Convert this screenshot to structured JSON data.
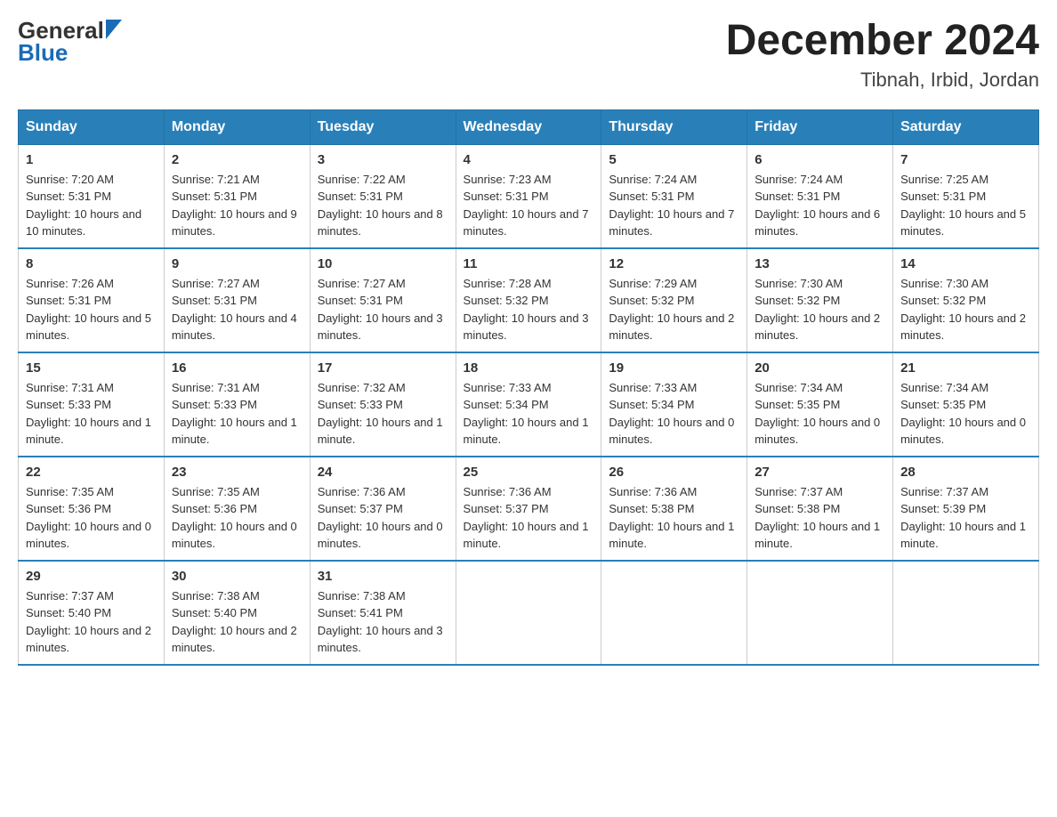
{
  "header": {
    "logo_general": "General",
    "logo_blue": "Blue",
    "month_title": "December 2024",
    "location": "Tibnah, Irbid, Jordan"
  },
  "columns": [
    "Sunday",
    "Monday",
    "Tuesday",
    "Wednesday",
    "Thursday",
    "Friday",
    "Saturday"
  ],
  "weeks": [
    [
      {
        "day": "1",
        "sunrise": "7:20 AM",
        "sunset": "5:31 PM",
        "daylight": "10 hours and 10 minutes."
      },
      {
        "day": "2",
        "sunrise": "7:21 AM",
        "sunset": "5:31 PM",
        "daylight": "10 hours and 9 minutes."
      },
      {
        "day": "3",
        "sunrise": "7:22 AM",
        "sunset": "5:31 PM",
        "daylight": "10 hours and 8 minutes."
      },
      {
        "day": "4",
        "sunrise": "7:23 AM",
        "sunset": "5:31 PM",
        "daylight": "10 hours and 7 minutes."
      },
      {
        "day": "5",
        "sunrise": "7:24 AM",
        "sunset": "5:31 PM",
        "daylight": "10 hours and 7 minutes."
      },
      {
        "day": "6",
        "sunrise": "7:24 AM",
        "sunset": "5:31 PM",
        "daylight": "10 hours and 6 minutes."
      },
      {
        "day": "7",
        "sunrise": "7:25 AM",
        "sunset": "5:31 PM",
        "daylight": "10 hours and 5 minutes."
      }
    ],
    [
      {
        "day": "8",
        "sunrise": "7:26 AM",
        "sunset": "5:31 PM",
        "daylight": "10 hours and 5 minutes."
      },
      {
        "day": "9",
        "sunrise": "7:27 AM",
        "sunset": "5:31 PM",
        "daylight": "10 hours and 4 minutes."
      },
      {
        "day": "10",
        "sunrise": "7:27 AM",
        "sunset": "5:31 PM",
        "daylight": "10 hours and 3 minutes."
      },
      {
        "day": "11",
        "sunrise": "7:28 AM",
        "sunset": "5:32 PM",
        "daylight": "10 hours and 3 minutes."
      },
      {
        "day": "12",
        "sunrise": "7:29 AM",
        "sunset": "5:32 PM",
        "daylight": "10 hours and 2 minutes."
      },
      {
        "day": "13",
        "sunrise": "7:30 AM",
        "sunset": "5:32 PM",
        "daylight": "10 hours and 2 minutes."
      },
      {
        "day": "14",
        "sunrise": "7:30 AM",
        "sunset": "5:32 PM",
        "daylight": "10 hours and 2 minutes."
      }
    ],
    [
      {
        "day": "15",
        "sunrise": "7:31 AM",
        "sunset": "5:33 PM",
        "daylight": "10 hours and 1 minute."
      },
      {
        "day": "16",
        "sunrise": "7:31 AM",
        "sunset": "5:33 PM",
        "daylight": "10 hours and 1 minute."
      },
      {
        "day": "17",
        "sunrise": "7:32 AM",
        "sunset": "5:33 PM",
        "daylight": "10 hours and 1 minute."
      },
      {
        "day": "18",
        "sunrise": "7:33 AM",
        "sunset": "5:34 PM",
        "daylight": "10 hours and 1 minute."
      },
      {
        "day": "19",
        "sunrise": "7:33 AM",
        "sunset": "5:34 PM",
        "daylight": "10 hours and 0 minutes."
      },
      {
        "day": "20",
        "sunrise": "7:34 AM",
        "sunset": "5:35 PM",
        "daylight": "10 hours and 0 minutes."
      },
      {
        "day": "21",
        "sunrise": "7:34 AM",
        "sunset": "5:35 PM",
        "daylight": "10 hours and 0 minutes."
      }
    ],
    [
      {
        "day": "22",
        "sunrise": "7:35 AM",
        "sunset": "5:36 PM",
        "daylight": "10 hours and 0 minutes."
      },
      {
        "day": "23",
        "sunrise": "7:35 AM",
        "sunset": "5:36 PM",
        "daylight": "10 hours and 0 minutes."
      },
      {
        "day": "24",
        "sunrise": "7:36 AM",
        "sunset": "5:37 PM",
        "daylight": "10 hours and 0 minutes."
      },
      {
        "day": "25",
        "sunrise": "7:36 AM",
        "sunset": "5:37 PM",
        "daylight": "10 hours and 1 minute."
      },
      {
        "day": "26",
        "sunrise": "7:36 AM",
        "sunset": "5:38 PM",
        "daylight": "10 hours and 1 minute."
      },
      {
        "day": "27",
        "sunrise": "7:37 AM",
        "sunset": "5:38 PM",
        "daylight": "10 hours and 1 minute."
      },
      {
        "day": "28",
        "sunrise": "7:37 AM",
        "sunset": "5:39 PM",
        "daylight": "10 hours and 1 minute."
      }
    ],
    [
      {
        "day": "29",
        "sunrise": "7:37 AM",
        "sunset": "5:40 PM",
        "daylight": "10 hours and 2 minutes."
      },
      {
        "day": "30",
        "sunrise": "7:38 AM",
        "sunset": "5:40 PM",
        "daylight": "10 hours and 2 minutes."
      },
      {
        "day": "31",
        "sunrise": "7:38 AM",
        "sunset": "5:41 PM",
        "daylight": "10 hours and 3 minutes."
      },
      null,
      null,
      null,
      null
    ]
  ]
}
